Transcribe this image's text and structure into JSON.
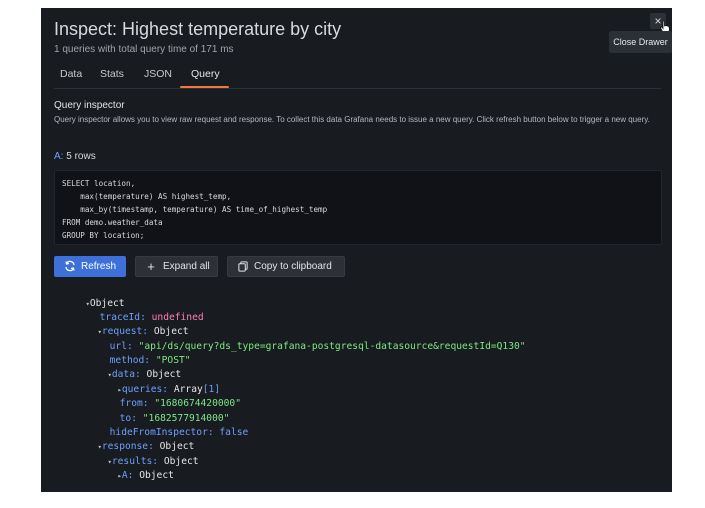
{
  "drawer": {
    "title": "Inspect: Highest temperature by city",
    "subtitle": "1 queries with total query time of 171 ms",
    "close_glyph": "×",
    "close_tooltip": "Close Drawer"
  },
  "tabs": [
    {
      "label": "Data",
      "active": false
    },
    {
      "label": "Stats",
      "active": false
    },
    {
      "label": "JSON",
      "active": false
    },
    {
      "label": "Query",
      "active": true
    }
  ],
  "query_inspector": {
    "title": "Query inspector",
    "description": "Query inspector allows you to view raw request and response. To collect this data Grafana needs to issue a new query. Click refresh button below to trigger a new query.",
    "query_prefix": "A:",
    "query_rows": "5 rows",
    "sql_lines": [
      "SELECT location,",
      "    max(temperature) AS highest_temp,",
      "    max_by(timestamp, temperature) AS time_of_highest_temp",
      "FROM demo.weather_data",
      "GROUP BY location;"
    ]
  },
  "buttons": {
    "refresh": "Refresh",
    "expand_all": "Expand all",
    "copy": "Copy to clipboard"
  },
  "tree": {
    "root": "Object",
    "traceId_key": "traceId:",
    "traceId_val": "undefined",
    "request_key": "request:",
    "request_val": "Object",
    "url_key": "url:",
    "url_val": "\"api/ds/query?ds_type=grafana-postgresql-datasource&requestId=Q130\"",
    "method_key": "method:",
    "method_val": "\"POST\"",
    "data_key": "data:",
    "data_val": "Object",
    "queries_key": "queries:",
    "queries_val": "Array",
    "queries_count": "[1]",
    "from_key": "from:",
    "from_val": "\"1680674420000\"",
    "to_key": "to:",
    "to_val": "\"1682577914000\"",
    "hide_key": "hideFromInspector:",
    "hide_val": "false",
    "response_key": "response:",
    "response_val": "Object",
    "results_key": "results:",
    "results_val": "Object",
    "a_key": "A:",
    "a_val": "Object"
  },
  "colors": {
    "background": "#181b1f",
    "accent_tab": "#f07a3e",
    "primary_button": "#3d71d9",
    "json_key": "#6e9fff",
    "json_string": "#7ee787",
    "json_undefined": "#ff7eb6"
  }
}
